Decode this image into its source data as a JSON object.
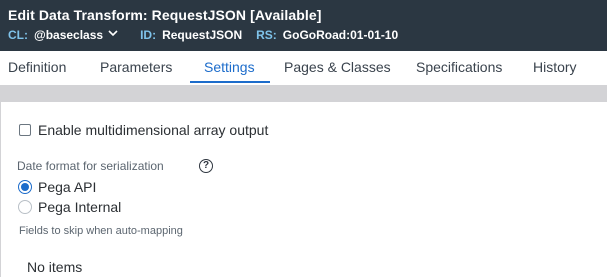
{
  "header": {
    "title": "Edit  Data Transform: RequestJSON [Available]",
    "meta": {
      "cl_key": "CL:",
      "cl_value": "@baseclass",
      "id_key": "ID:",
      "id_value": "RequestJSON",
      "rs_key": "RS:",
      "rs_value": "GoGoRoad:01-01-10"
    }
  },
  "tabs": [
    {
      "label": "Definition"
    },
    {
      "label": "Parameters"
    },
    {
      "label": "Settings",
      "active": true
    },
    {
      "label": "Pages & Classes"
    },
    {
      "label": "Specifications"
    },
    {
      "label": "History"
    }
  ],
  "settings": {
    "multidim_checkbox_label": "Enable multidimensional array output",
    "multidim_checked": false,
    "date_format_label": "Date format for serialization",
    "help_glyph": "?",
    "radio_options": [
      {
        "label": "Pega API",
        "checked": true
      },
      {
        "label": "Pega Internal",
        "checked": false
      }
    ],
    "skip_fields_label": "Fields to skip when auto-mapping",
    "no_items_text": "No items"
  },
  "colors": {
    "header_bg": "#2b3742",
    "meta_key": "#7fc3ea",
    "accent": "#1c6ccb",
    "band": "#d3d3d6"
  },
  "icons": {
    "cl_dropdown": "chevron-down-icon",
    "help": "help-icon"
  }
}
